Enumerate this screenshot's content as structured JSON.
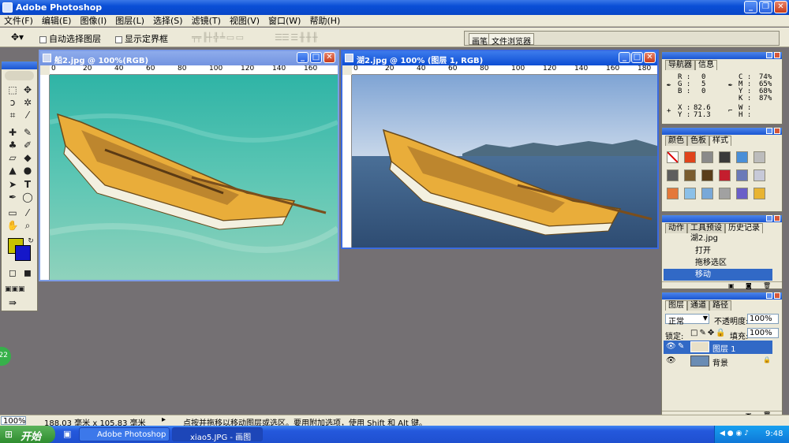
{
  "app": {
    "title": "Adobe Photoshop"
  },
  "menu": [
    "文件(F)",
    "编辑(E)",
    "图像(I)",
    "图层(L)",
    "选择(S)",
    "滤镜(T)",
    "视图(V)",
    "窗口(W)",
    "帮助(H)"
  ],
  "options": {
    "auto_select": "自动选择图层",
    "show_bounds": "显示定界框"
  },
  "palette_well": {
    "tab1": "画笔",
    "tab2": "文件浏览器"
  },
  "doc1": {
    "title": "船2.jpg @ 100%(RGB)",
    "ruler": [
      "0",
      "20",
      "40",
      "60",
      "80",
      "100",
      "120",
      "140",
      "160"
    ]
  },
  "doc2": {
    "title": "湖2.jpg @ 100% (图层 1, RGB)",
    "ruler": [
      "0",
      "20",
      "40",
      "60",
      "80",
      "100",
      "120",
      "140",
      "160",
      "180"
    ]
  },
  "navigator": {
    "tab_nav": "导航器",
    "tab_info": "信息",
    "r": "R :",
    "r_val": "0",
    "g": "G :",
    "g_val": "5",
    "b": "B :",
    "b_val": "0",
    "c": "C :",
    "c_val": "74%",
    "m": "M :",
    "m_val": "65%",
    "y": "Y :",
    "y_val": "68%",
    "k": "K :",
    "k_val": "87%",
    "x": "X :",
    "x_val": "82.6",
    "yy": "Y :",
    "yy_val": "71.3",
    "w": "W :",
    "h": "H :"
  },
  "swatches": {
    "tab_color": "颜色",
    "tab_swatch": "色板",
    "tab_style": "样式"
  },
  "history": {
    "tab_actions": "动作",
    "tab_presets": "工具预设",
    "tab_history": "历史记录",
    "snapshot": "湖2.jpg",
    "items": [
      "打开",
      "拖移选区",
      "移动"
    ]
  },
  "layers": {
    "tab_layers": "图层",
    "tab_channels": "通道",
    "tab_paths": "路径",
    "blend": "正常",
    "opacity_label": "不透明度:",
    "opacity": "100%",
    "lock_label": "锁定:",
    "fill_label": "填充:",
    "fill": "100%",
    "items": [
      "图层 1",
      "背景"
    ]
  },
  "status": {
    "zoom": "100%",
    "size": "188.03 毫米 x 105.83 毫米",
    "hint": "点按并拖移以移动图层或选区。要用附加选项，使用 Shift 和 Alt 键。"
  },
  "taskbar": {
    "start": "开始",
    "task1": "Adobe Photoshop",
    "task2": "xiao5.JPG - 画图",
    "clock": "9:48"
  },
  "badge": {
    "text": "22"
  },
  "colors": {
    "foreground": "#c7c200",
    "background": "#1517c9",
    "xp_blue": "#245edb"
  }
}
